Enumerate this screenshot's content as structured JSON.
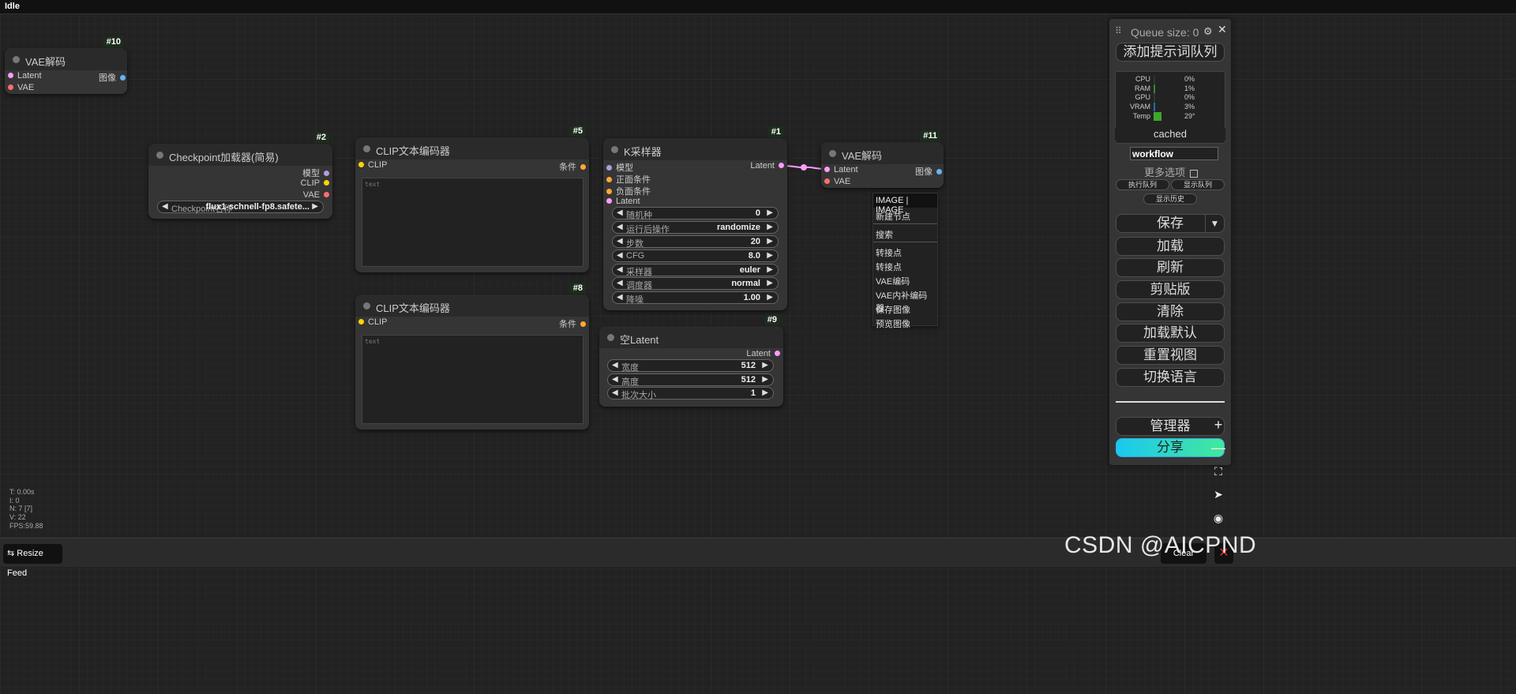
{
  "status": "Idle",
  "colors": {
    "clip_pin": "#ffd500",
    "model_pin": "#b39ddb",
    "vae_pin": "#ff6e6e",
    "latent_pin": "#ff9cf9",
    "image_pin": "#64b5f6",
    "cond_pin": "#ffa931",
    "share_gradient_start": "#1ac8f0",
    "share_gradient_end": "#43e89b"
  },
  "nodes": {
    "vae_decode_10": {
      "id": "#10",
      "title": "VAE解码",
      "in1": "Latent",
      "in2": "VAE",
      "out": "图像"
    },
    "checkpoint": {
      "id": "#2",
      "title": "Checkpoint加载器(简易)",
      "out_model": "模型",
      "out_clip": "CLIP",
      "out_vae": "VAE",
      "ckpt_label": "Checkpoint名称",
      "ckpt_value": "flux1-schnell-fp8.safete..."
    },
    "clip_5": {
      "id": "#5",
      "title": "CLIP文本编码器",
      "in": "CLIP",
      "out": "条件",
      "text": "text"
    },
    "clip_8": {
      "id": "#8",
      "title": "CLIP文本编码器",
      "in": "CLIP",
      "out": "条件",
      "text": "text"
    },
    "ksampler": {
      "id": "#1",
      "title": "K采样器",
      "in_model": "模型",
      "in_pos": "正面条件",
      "in_neg": "负面条件",
      "in_latent": "Latent",
      "out": "Latent",
      "widgets": [
        {
          "label": "随机种",
          "value": "0"
        },
        {
          "label": "运行后操作",
          "value": "randomize"
        },
        {
          "label": "步数",
          "value": "20"
        },
        {
          "label": "CFG",
          "value": "8.0"
        },
        {
          "label": "采样器",
          "value": "euler"
        },
        {
          "label": "调度器",
          "value": "normal"
        },
        {
          "label": "降噪",
          "value": "1.00"
        }
      ]
    },
    "empty_latent": {
      "id": "#9",
      "title": "空Latent",
      "out": "Latent",
      "widgets": [
        {
          "label": "宽度",
          "value": "512"
        },
        {
          "label": "高度",
          "value": "512"
        },
        {
          "label": "批次大小",
          "value": "1"
        }
      ]
    },
    "vae_decode_11": {
      "id": "#11",
      "title": "VAE解码",
      "in1": "Latent",
      "in2": "VAE",
      "out": "图像"
    }
  },
  "context_menu": {
    "header": "IMAGE | IMAGE",
    "items": [
      "新建节点",
      "搜索",
      "转接点",
      "转接点",
      "VAE编码",
      "VAE内补编码器",
      "保存图像",
      "预览图像"
    ]
  },
  "panel": {
    "queue_size": "Queue size: 0",
    "queue_button": "添加提示词队列",
    "monitor": [
      {
        "label": "CPU",
        "value": "0%",
        "fill": 0,
        "color": "#2f8a2f"
      },
      {
        "label": "RAM",
        "value": "1%",
        "fill": 0.01,
        "color": "#2f8a2f"
      },
      {
        "label": "GPU",
        "value": "0%",
        "fill": 0,
        "color": "#2f8a2f"
      },
      {
        "label": "VRAM",
        "value": "3%",
        "fill": 0.03,
        "color": "#1f6fb0"
      },
      {
        "label": "Temp",
        "value": "29°",
        "fill": 0.29,
        "color": "#3ca82b"
      }
    ],
    "cached": "cached",
    "workflow_name": "workflow",
    "more_options": "更多选项",
    "exec_queue": "执行队列",
    "show_queue": "显示队列",
    "show_history": "显示历史",
    "save": "保存",
    "load": "加载",
    "refresh": "刷新",
    "clipboard": "剪贴版",
    "clear": "清除",
    "load_default": "加载默认",
    "reset_view": "重置视图",
    "switch_lang": "切换语言",
    "manager": "管理器",
    "share": "分享"
  },
  "stats": [
    "T: 0.00s",
    "I: 0",
    "N: 7 [7]",
    "V: 22",
    "FPS:59.88"
  ],
  "bottom": {
    "resize_feed": "Resize Feed",
    "clear": "Clear",
    "watermark": "CSDN @AICPND"
  }
}
